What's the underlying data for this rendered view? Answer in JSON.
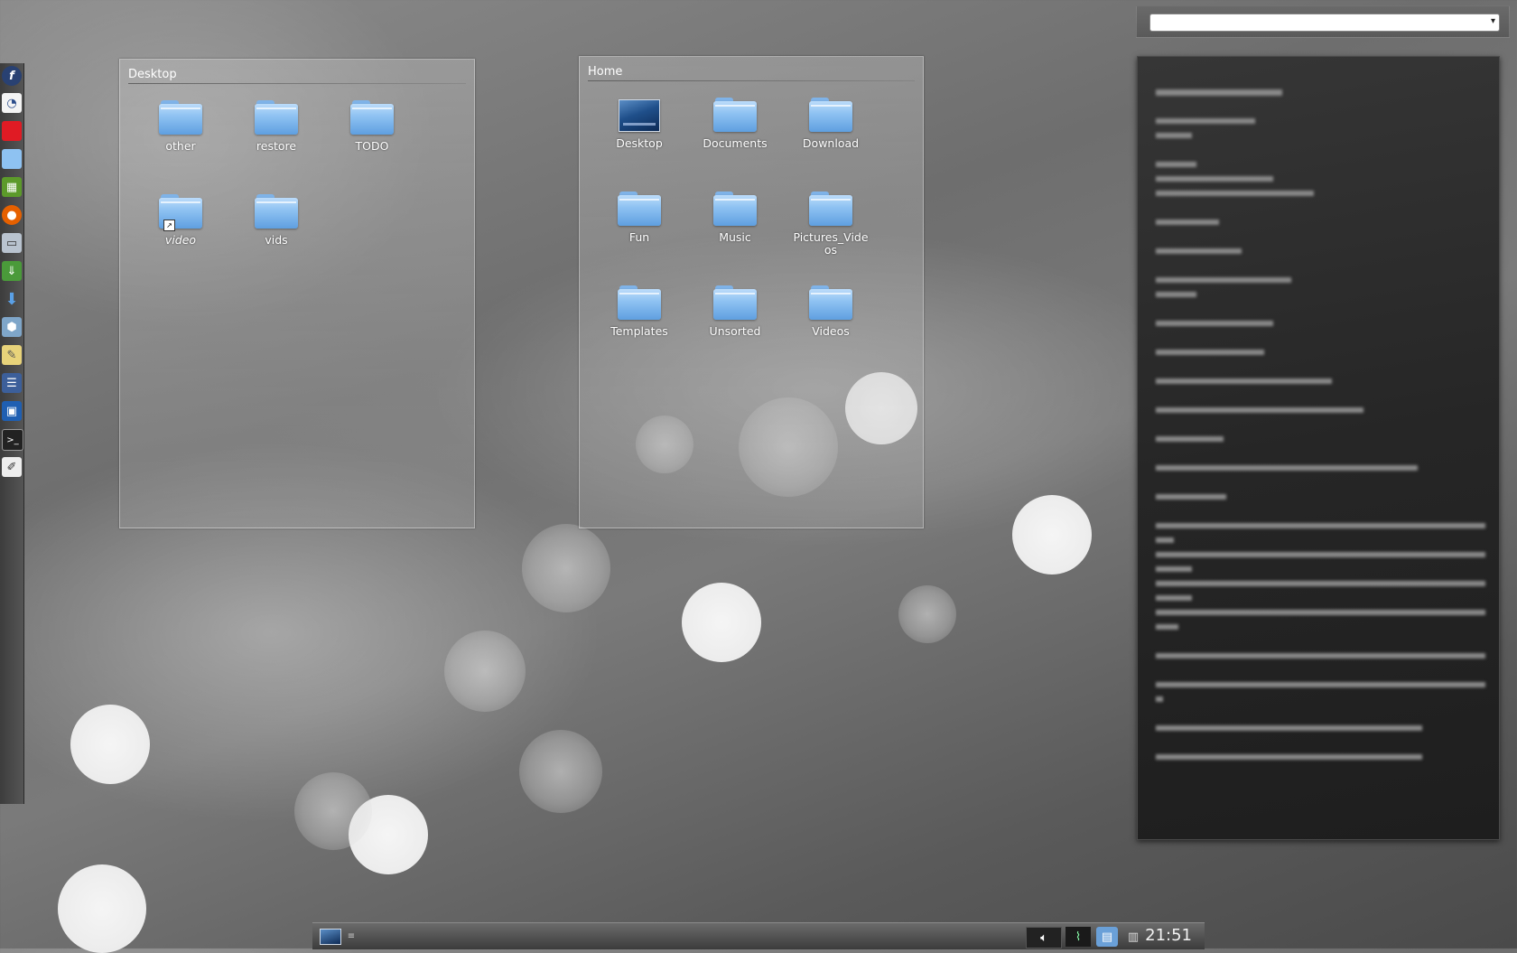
{
  "desktop_folderview": {
    "title": "Desktop",
    "items": [
      {
        "label": "other"
      },
      {
        "label": "restore"
      },
      {
        "label": "TODO"
      },
      {
        "label": "video"
      },
      {
        "label": "vids"
      }
    ]
  },
  "home_folderview": {
    "title": "Home",
    "items": [
      {
        "label": "Desktop"
      },
      {
        "label": "Documents"
      },
      {
        "label": "Download"
      },
      {
        "label": "Fun"
      },
      {
        "label": "Music"
      },
      {
        "label": "Pictures_Videos"
      },
      {
        "label": "Templates"
      },
      {
        "label": "Unsorted"
      },
      {
        "label": "Videos"
      }
    ]
  },
  "launcher": {
    "icons": [
      "fedora-icon",
      "document-viewer-icon",
      "red-box-icon",
      "folder-icon",
      "spreadsheet-icon",
      "firefox-icon",
      "drive-icon",
      "download-manager-icon",
      "download-arrow-icon",
      "package-icon",
      "notes-folder-icon",
      "network-icon",
      "monitor-icon",
      "terminal-icon",
      "text-editor-icon"
    ]
  },
  "taskbar": {
    "clock": "21:51",
    "tray_icons": [
      "volume-icon",
      "system-monitor-icon",
      "network-manager-icon",
      "clipboard-icon"
    ]
  },
  "note_widget": {
    "combo_value": "",
    "combo_arrow": "▾"
  },
  "colors": {
    "folder_blue": "#8ec2f2",
    "note_bg": "#262626",
    "panel_bg": "#4a4a4a"
  }
}
